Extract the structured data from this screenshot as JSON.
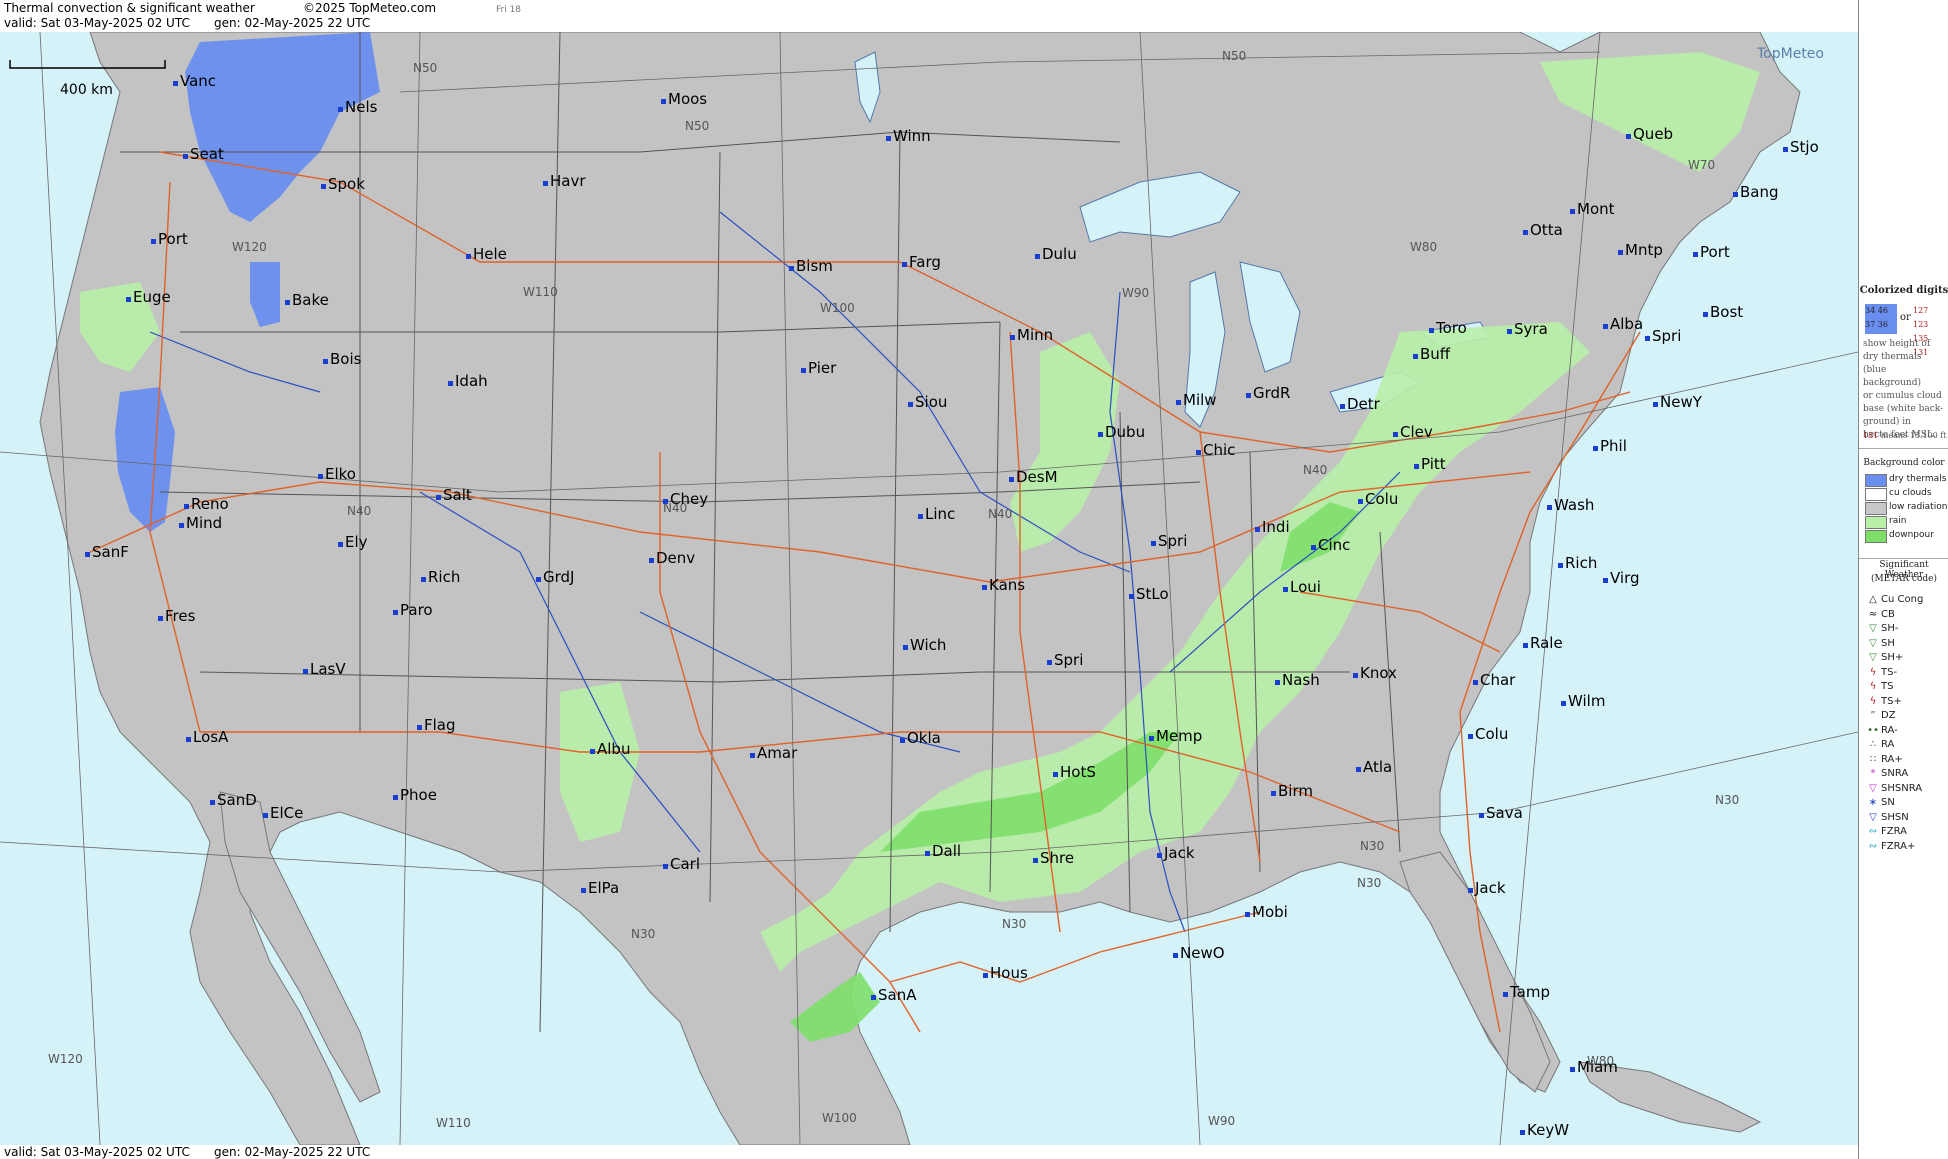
{
  "header": {
    "title": "Thermal convection & significant weather",
    "copyright": "©2025 TopMeteo.com",
    "day": "Fri 18",
    "valid": "valid:  Sat  03-May-2025  02 UTC",
    "gen": "gen: 02-May-2025 22 UTC"
  },
  "footer": {
    "valid": "valid:  Sat  03-May-2025  02 UTC",
    "gen": "gen: 02-May-2025 22 UTC"
  },
  "logo": "TopMeteo",
  "scale": "400 km",
  "cities": [
    {
      "name": "Vanc"
    },
    {
      "name": "Nels"
    },
    {
      "name": "Moos"
    },
    {
      "name": "Seat"
    },
    {
      "name": "Spok"
    },
    {
      "name": "Havr"
    },
    {
      "name": "Winn"
    },
    {
      "name": "Port"
    },
    {
      "name": "Hele"
    },
    {
      "name": "Bism"
    },
    {
      "name": "Farg"
    },
    {
      "name": "Dulu"
    },
    {
      "name": "Euge"
    },
    {
      "name": "Bake"
    },
    {
      "name": "Bois"
    },
    {
      "name": "Idah"
    },
    {
      "name": "Pier"
    },
    {
      "name": "Minn"
    },
    {
      "name": "Siou"
    },
    {
      "name": "Milw"
    },
    {
      "name": "GrdR"
    },
    {
      "name": "Toro"
    },
    {
      "name": "Buff"
    },
    {
      "name": "Syra"
    },
    {
      "name": "Alba"
    },
    {
      "name": "Spri"
    },
    {
      "name": "Bost"
    },
    {
      "name": "NewY"
    },
    {
      "name": "Phil"
    },
    {
      "name": "Otta"
    },
    {
      "name": "Mont"
    },
    {
      "name": "Mntp"
    },
    {
      "name": "Port"
    },
    {
      "name": "Bang"
    },
    {
      "name": "Queb"
    },
    {
      "name": "Stjo"
    },
    {
      "name": "Elko"
    },
    {
      "name": "Salt"
    },
    {
      "name": "Chey"
    },
    {
      "name": "Reno"
    },
    {
      "name": "Mind"
    },
    {
      "name": "SanF"
    },
    {
      "name": "Ely"
    },
    {
      "name": "Rich"
    },
    {
      "name": "GrdJ"
    },
    {
      "name": "Denv"
    },
    {
      "name": "Linc"
    },
    {
      "name": "DesM"
    },
    {
      "name": "Dubu"
    },
    {
      "name": "Chic"
    },
    {
      "name": "Detr"
    },
    {
      "name": "Clev"
    },
    {
      "name": "Pitt"
    },
    {
      "name": "Colu"
    },
    {
      "name": "Wash"
    },
    {
      "name": "Rich"
    },
    {
      "name": "Virg"
    },
    {
      "name": "Indi"
    },
    {
      "name": "Cinc"
    },
    {
      "name": "Loui"
    },
    {
      "name": "Spri"
    },
    {
      "name": "StLo"
    },
    {
      "name": "Kans"
    },
    {
      "name": "Fres"
    },
    {
      "name": "Paro"
    },
    {
      "name": "LasV"
    },
    {
      "name": "Wich"
    },
    {
      "name": "Spri"
    },
    {
      "name": "Nash"
    },
    {
      "name": "Knox"
    },
    {
      "name": "Rale"
    },
    {
      "name": "Char"
    },
    {
      "name": "Wilm"
    },
    {
      "name": "LosA"
    },
    {
      "name": "Flag"
    },
    {
      "name": "Albu"
    },
    {
      "name": "Amar"
    },
    {
      "name": "Okla"
    },
    {
      "name": "Memp"
    },
    {
      "name": "Colu"
    },
    {
      "name": "SanD"
    },
    {
      "name": "ElCe"
    },
    {
      "name": "Phoe"
    },
    {
      "name": "HotS"
    },
    {
      "name": "Birm"
    },
    {
      "name": "Atla"
    },
    {
      "name": "Sava"
    },
    {
      "name": "Carl"
    },
    {
      "name": "Dall"
    },
    {
      "name": "Shre"
    },
    {
      "name": "Jack"
    },
    {
      "name": "ElPa"
    },
    {
      "name": "Jack"
    },
    {
      "name": "Mobi"
    },
    {
      "name": "NewO"
    },
    {
      "name": "Hous"
    },
    {
      "name": "SanA"
    },
    {
      "name": "Tamp"
    },
    {
      "name": "Miam"
    },
    {
      "name": "KeyW"
    }
  ],
  "grid_labels": [
    "N50",
    "N50",
    "N50",
    "N40",
    "N40",
    "N40",
    "N40",
    "N30",
    "N30",
    "N30",
    "N30",
    "N30",
    "W110",
    "W100",
    "W90",
    "W80",
    "W70",
    "W120",
    "W120",
    "W110",
    "W100",
    "W90",
    "W80"
  ],
  "legend": {
    "colorized_title": "Colorized digits",
    "or": "or",
    "digits_blue": [
      "34",
      "46",
      "37",
      "36"
    ],
    "digits_white": [
      "127",
      "123",
      "135",
      "131"
    ],
    "description": [
      "show height of",
      "dry thermals",
      "(blue background)",
      "or cumulus cloud",
      "base (white back-",
      "ground) in",
      "hecto feet MSL."
    ],
    "example_value": "131",
    "example_text": "means 13.100 ft",
    "bg_title": "Background color",
    "bg_items": [
      {
        "label": "dry thermals",
        "color": "#6a8ef0"
      },
      {
        "label": "cu clouds",
        "color": "#ffffff"
      },
      {
        "label": "low radiation",
        "color": "#c8c8c8"
      },
      {
        "label": "rain",
        "color": "#b8f0a8"
      },
      {
        "label": "downpour",
        "color": "#7ddf6a"
      }
    ],
    "sig_title": [
      "Significant Weather",
      "(METAR code)"
    ],
    "sig_items": [
      {
        "label": "Cu Cong",
        "glyph": "△"
      },
      {
        "label": "CB",
        "glyph": "≈"
      },
      {
        "label": "SH-",
        "glyph": "▽"
      },
      {
        "label": "SH",
        "glyph": "▽"
      },
      {
        "label": "SH+",
        "glyph": "▽"
      },
      {
        "label": "TS-",
        "glyph": "ϟ"
      },
      {
        "label": "TS",
        "glyph": "ϟ"
      },
      {
        "label": "TS+",
        "glyph": "ϟ"
      },
      {
        "label": "DZ",
        "glyph": "”"
      },
      {
        "label": "RA-",
        "glyph": "••"
      },
      {
        "label": "RA",
        "glyph": "∴"
      },
      {
        "label": "RA+",
        "glyph": "∷"
      },
      {
        "label": "SNRA",
        "glyph": "*"
      },
      {
        "label": "SHSNRA",
        "glyph": "▽"
      },
      {
        "label": "SN",
        "glyph": "∗"
      },
      {
        "label": "SHSN",
        "glyph": "▽"
      },
      {
        "label": "FZRA",
        "glyph": "∾"
      },
      {
        "label": "FZRA+",
        "glyph": "∾"
      }
    ],
    "sig_colors": [
      "#222",
      "#222",
      "#3a8a3a",
      "#3a8a3a",
      "#3a8a3a",
      "#b02020",
      "#b02020",
      "#b02020",
      "#3a6a1a",
      "#3a6a1a",
      "#1a5a1a",
      "#1a5a1a",
      "#c030c0",
      "#c030c0",
      "#2040c0",
      "#2040c0",
      "#20a0c0",
      "#20a0c0"
    ]
  },
  "colors": {
    "land": "#c3c3c3",
    "ocean": "#d4f2f8",
    "lakes": "#d4f2f8",
    "roads": "#e0622a",
    "rivers": "#2a4fc0",
    "borders": "#444",
    "grid": "#555",
    "dry": "#6a8ef0",
    "rain": "#b8f0a8",
    "downpour": "#7ddf6a"
  }
}
